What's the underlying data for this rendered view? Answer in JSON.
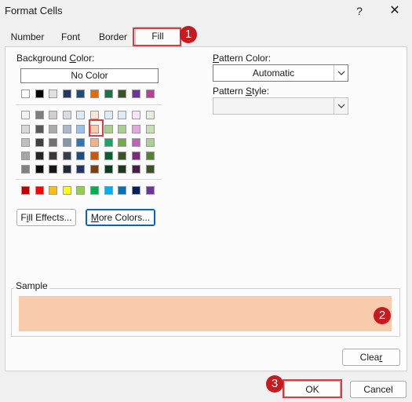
{
  "window": {
    "title": "Format Cells",
    "help": "?",
    "close": "✕"
  },
  "tabs": [
    {
      "label": "Number"
    },
    {
      "label": "Font"
    },
    {
      "label": "Border"
    },
    {
      "label": "Fill",
      "active": true
    }
  ],
  "fill": {
    "background_color_label": "Background Color:",
    "background_color_accel": "C",
    "no_color_button": "No Color",
    "theme_row": [
      "#ffffff",
      "#000000",
      "#e7e6e6",
      "#44546a",
      "#4472c4",
      "#ed7d31",
      "#a9a9a9",
      "#ffc000",
      "#5b9bd5",
      "#70ad47"
    ],
    "theme_row_display": [
      "#ffffff",
      "#000000",
      "#e0e0e0",
      "#1f3864",
      "#1f4e79",
      "#e26b0a",
      "#1e7145",
      "#375623",
      "#7030a0",
      "#c0399b"
    ],
    "tints": [
      [
        "#f2f2f2",
        "#7f7f7f",
        "#d0cece",
        "#d6dce4",
        "#ddebf7",
        "#fce4d6",
        "#ddebf7",
        "#ddebf7",
        "#fce4f6",
        "#e2efda"
      ],
      [
        "#d9d9d9",
        "#595959",
        "#aeaaaa",
        "#acb9ca",
        "#9bc2e6",
        "#f8cbad",
        "#a9d08e",
        "#a9d08e",
        "#e4a6e0",
        "#c6e0b4"
      ],
      [
        "#bfbfbf",
        "#3f3f3f",
        "#757171",
        "#8497b0",
        "#2f75b5",
        "#f4b084",
        "#21a366",
        "#70ad47",
        "#c45fc0",
        "#a9d08e"
      ],
      [
        "#a6a6a6",
        "#262626",
        "#3a3838",
        "#333f4f",
        "#1f4e78",
        "#c65911",
        "#0e5c31",
        "#375623",
        "#7b2c7b",
        "#548235"
      ],
      [
        "#808080",
        "#0d0d0d",
        "#171616",
        "#222b35",
        "#203764",
        "#833c0c",
        "#0b3d20",
        "#1e3a1e",
        "#4d1a4d",
        "#375623"
      ]
    ],
    "standard_colors": [
      "#c00000",
      "#ff0000",
      "#ffc000",
      "#ffff00",
      "#92d050",
      "#00b050",
      "#00b0f0",
      "#0070c0",
      "#002060",
      "#7030a0"
    ],
    "fill_effects_button": "Fill Effects...",
    "fill_effects_accel": "i",
    "more_colors_button": "More Colors...",
    "more_colors_accel": "M",
    "pattern_color_label": "Pattern Color:",
    "pattern_color_accel": "P",
    "pattern_color_value": "Automatic",
    "pattern_style_label": "Pattern Style:",
    "pattern_style_accel": "S",
    "pattern_style_value": "",
    "sample_label": "Sample",
    "sample_color": "#f8cbad",
    "clear_button": "Clear",
    "clear_accel": "r"
  },
  "footer": {
    "ok_button": "OK",
    "cancel_button": "Cancel"
  },
  "annotations": {
    "step1": "1",
    "step2": "2",
    "step3": "3",
    "badge_color": "#c8191e",
    "highlight_color": "#e03a3a"
  }
}
